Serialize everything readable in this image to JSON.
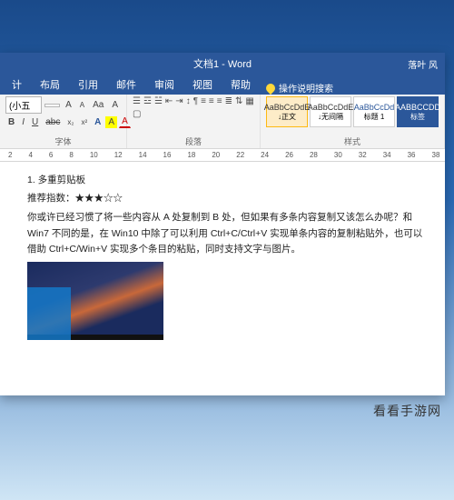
{
  "titlebar": {
    "title": "文档1 - Word",
    "user": "落叶 风"
  },
  "tabs": {
    "items": [
      "计",
      "布局",
      "引用",
      "邮件",
      "审阅",
      "视图",
      "帮助"
    ],
    "tell_me": "操作说明搜索"
  },
  "ribbon": {
    "font": {
      "name": "(小五",
      "size": "",
      "grow": "A",
      "shrink": "A",
      "clear": "Aa",
      "phonetic": "A",
      "bold": "B",
      "italic": "I",
      "underline": "U",
      "strike": "abc",
      "sub": "x₂",
      "sup": "x²",
      "effects": "A",
      "highlight": "A",
      "color": "A",
      "label": "字体"
    },
    "paragraph": {
      "label": "段落"
    },
    "styles": {
      "label": "样式",
      "items": [
        {
          "preview": "AaBbCcDdE",
          "name": "↓正文"
        },
        {
          "preview": "AaBbCcDdE",
          "name": "↓无间隔"
        },
        {
          "preview": "AaBbCcDd",
          "name": "标题 1"
        },
        {
          "preview": "AABBCCDD",
          "name": "标签"
        }
      ]
    }
  },
  "ruler": [
    "2",
    "4",
    "6",
    "8",
    "10",
    "12",
    "14",
    "16",
    "18",
    "20",
    "22",
    "24",
    "26",
    "28",
    "30",
    "32",
    "34",
    "36",
    "38"
  ],
  "document": {
    "heading": "1. 多重剪贴板",
    "rating_label": "推荐指数：",
    "rating_stars": "★★★☆☆",
    "body": "你或许已经习惯了将一些内容从 A 处复制到 B 处，但如果有多条内容复制又该怎么办呢？和 Win7 不同的是，在 Win10 中除了可以利用 Ctrl+C/Ctrl+V 实现单条内容的复制粘贴外，也可以借助 Ctrl+C/Win+V 实现多个条目的粘贴，同时支持文字与图片。"
  },
  "watermark": "看看手游网"
}
